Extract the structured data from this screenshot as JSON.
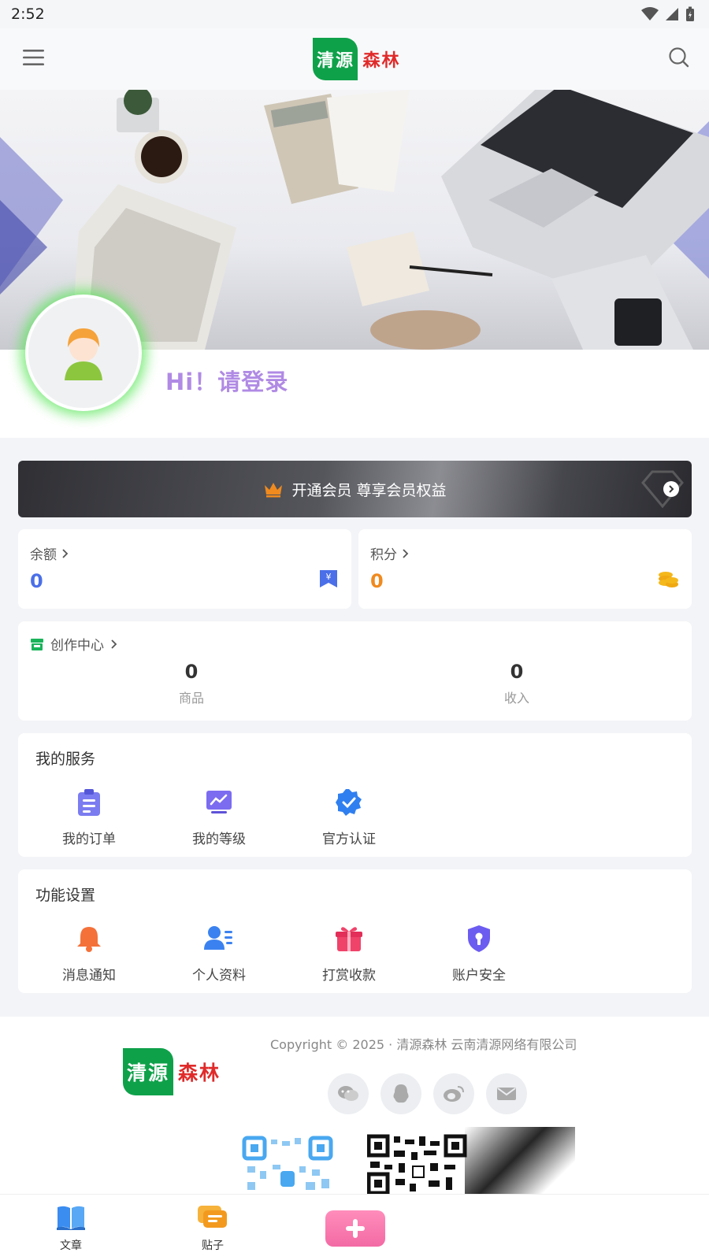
{
  "status_bar": {
    "time": "2:52"
  },
  "header": {
    "logo_mark": "清源",
    "logo_text": "森林"
  },
  "profile": {
    "greeting": "Hi！请登录"
  },
  "vip": {
    "label": "开通会员 尊享会员权益"
  },
  "stats": {
    "balance": {
      "label": "余额",
      "value": "0",
      "color": "#4a6fe8"
    },
    "points": {
      "label": "积分",
      "value": "0",
      "color": "#f08a1e"
    }
  },
  "creation": {
    "title": "创作中心",
    "goods": {
      "value": "0",
      "label": "商品"
    },
    "income": {
      "value": "0",
      "label": "收入"
    }
  },
  "services": {
    "title": "我的服务",
    "items": [
      {
        "label": "我的订单",
        "icon": "clipboard-icon"
      },
      {
        "label": "我的等级",
        "icon": "chart-icon"
      },
      {
        "label": "官方认证",
        "icon": "verified-icon"
      }
    ]
  },
  "settings": {
    "title": "功能设置",
    "items": [
      {
        "label": "消息通知",
        "icon": "bell-icon"
      },
      {
        "label": "个人资料",
        "icon": "profile-icon"
      },
      {
        "label": "打赏收款",
        "icon": "gift-icon"
      },
      {
        "label": "账户安全",
        "icon": "shield-icon"
      }
    ]
  },
  "footer": {
    "copyright": "Copyright © 2025 · 清源森林 云南清源网络有限公司",
    "logo_mark": "清源",
    "logo_text": "森林",
    "social": [
      "wechat-icon",
      "qq-icon",
      "weibo-icon",
      "mail-icon"
    ]
  },
  "bottom_nav": {
    "items": [
      {
        "label": "文章",
        "icon": "book-icon"
      },
      {
        "label": "贴子",
        "icon": "chat-icon"
      }
    ]
  },
  "colors": {
    "brand_green": "#0fa14a",
    "brand_red": "#e02a2a",
    "vip_accent": "#f08a1e",
    "greeting": "#b08ae4"
  }
}
